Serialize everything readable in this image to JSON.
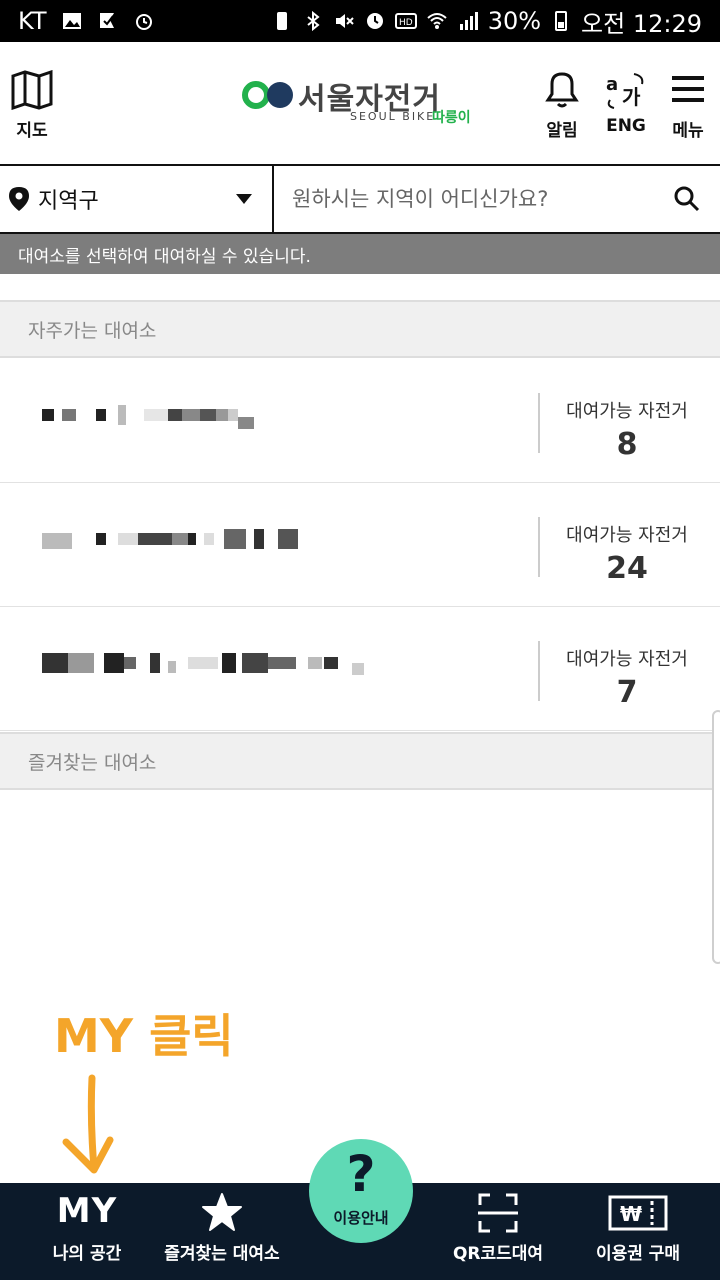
{
  "status_bar": {
    "carrier": "KT",
    "battery": "30%",
    "time": "오전 12:29"
  },
  "header": {
    "map_label": "지도",
    "logo_title": "서울자전거",
    "logo_sub": "SEOUL BIKE",
    "logo_sub2": "따릉이",
    "alarm_label": "알림",
    "lang_label": "ENG",
    "menu_label": "메뉴"
  },
  "search": {
    "district_label": "지역구",
    "placeholder": "원하시는 지역이 어디신가요?"
  },
  "notice": "대여소를 선택하여 대여하실 수 있습니다.",
  "frequent": {
    "header": "자주가는 대여소",
    "stations": [
      {
        "available_label": "대여가능 자전거",
        "count": "8"
      },
      {
        "available_label": "대여가능 자전거",
        "count": "24"
      },
      {
        "available_label": "대여가능 자전거",
        "count": "7"
      }
    ]
  },
  "favorites": {
    "header": "즐겨찾는 대여소"
  },
  "annotation": "MY 클릭",
  "bottom_nav": {
    "my_icon_text": "MY",
    "my_label": "나의 공간",
    "fav_label": "즐겨찾는 대여소",
    "guide_label": "이용안내",
    "qr_label": "QR코드대여",
    "ticket_label": "이용권 구매"
  },
  "colors": {
    "accent_green": "#22b14c",
    "guide_mint": "#5fd9b5",
    "nav_bg": "#0c1a2a",
    "notice_bg": "#7d7d7d",
    "annotation": "#f4a52a"
  }
}
